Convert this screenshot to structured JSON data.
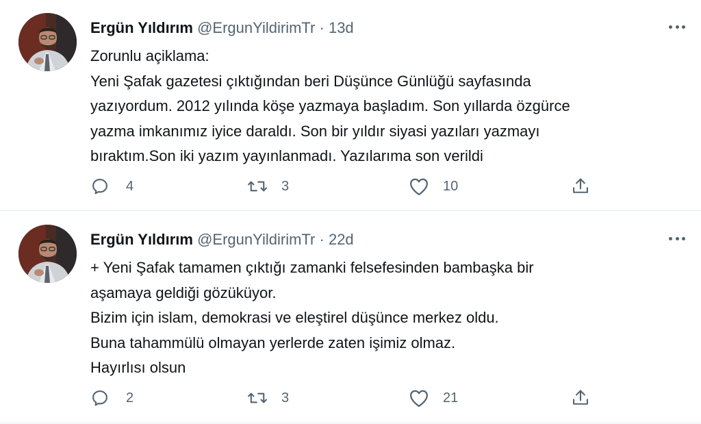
{
  "tweets": [
    {
      "author": {
        "name": "Ergün Yıldırım",
        "handle": "@ErgunYildirimTr",
        "separator": "·",
        "time": "13d",
        "avatar_icon": "profile-photo"
      },
      "text_lines": [
        "Zorunlu açiklama:",
        "Yeni Şafak gazetesi çıktığından beri Düşünce Günlüğü sayfasında",
        "yazıyordum. 2012 yılında köşe yazmaya başladım. Son yıllarda özgürce",
        "yazma imkanımız iyice daraldı. Son bir yıldır siyasi yazıları yazmayı",
        "bıraktım.Son iki yazım yayınlanmadı. Yazılarıma son verildi"
      ],
      "actions": {
        "reply_count": "4",
        "retweet_count": "3",
        "like_count": "10",
        "reply_icon": "reply-icon",
        "retweet_icon": "retweet-icon",
        "like_icon": "heart-icon",
        "share_icon": "share-icon"
      }
    },
    {
      "author": {
        "name": "Ergün Yıldırım",
        "handle": "@ErgunYildirimTr",
        "separator": "·",
        "time": "22d",
        "avatar_icon": "profile-photo"
      },
      "text_lines": [
        "+ Yeni Şafak tamamen çıktığı zamanki felsefesinden bambaşka bir",
        "aşamaya geldiği gözüküyor.",
        "Bizim için islam, demokrasi ve eleştirel düşünce merkez oldu.",
        "Buna tahammülü olmayan yerlerde zaten işimiz olmaz.",
        "Hayırlısı olsun"
      ],
      "actions": {
        "reply_count": "2",
        "retweet_count": "3",
        "like_count": "21",
        "reply_icon": "reply-icon",
        "retweet_icon": "retweet-icon",
        "like_icon": "heart-icon",
        "share_icon": "share-icon"
      }
    }
  ],
  "colors": {
    "text": "#0f1419",
    "secondary": "#536471",
    "divider": "#e6ecf0"
  }
}
